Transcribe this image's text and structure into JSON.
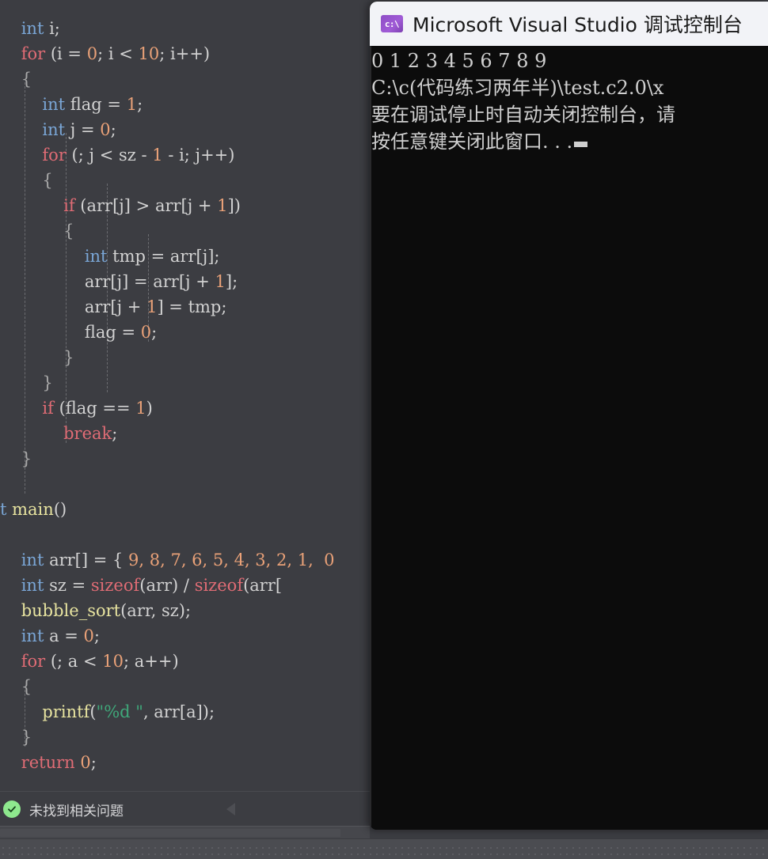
{
  "editor": {
    "background_color": "#3c3d42",
    "code_lines": [
      [
        {
          "t": "    ",
          "c": "plain"
        },
        {
          "t": "int",
          "c": "type"
        },
        {
          "t": " i;",
          "c": "plain"
        }
      ],
      [
        {
          "t": "    ",
          "c": "plain"
        },
        {
          "t": "for",
          "c": "kw"
        },
        {
          "t": " (i = ",
          "c": "plain"
        },
        {
          "t": "0",
          "c": "num"
        },
        {
          "t": "; i ",
          "c": "plain"
        },
        {
          "t": "<",
          "c": "plain"
        },
        {
          "t": " ",
          "c": "plain"
        },
        {
          "t": "10",
          "c": "num"
        },
        {
          "t": "; i++)",
          "c": "plain"
        }
      ],
      [
        {
          "t": "    ",
          "c": "plain"
        },
        {
          "t": "{",
          "c": "brace"
        }
      ],
      [
        {
          "t": "        ",
          "c": "plain"
        },
        {
          "t": "int",
          "c": "type"
        },
        {
          "t": " flag = ",
          "c": "plain"
        },
        {
          "t": "1",
          "c": "num"
        },
        {
          "t": ";",
          "c": "plain"
        }
      ],
      [
        {
          "t": "        ",
          "c": "plain"
        },
        {
          "t": "int",
          "c": "type"
        },
        {
          "t": " j = ",
          "c": "plain"
        },
        {
          "t": "0",
          "c": "num"
        },
        {
          "t": ";",
          "c": "plain"
        }
      ],
      [
        {
          "t": "        ",
          "c": "plain"
        },
        {
          "t": "for",
          "c": "kw"
        },
        {
          "t": " (; j ",
          "c": "plain"
        },
        {
          "t": "<",
          "c": "plain"
        },
        {
          "t": " sz - ",
          "c": "plain"
        },
        {
          "t": "1",
          "c": "num"
        },
        {
          "t": " - i; j++)",
          "c": "plain"
        }
      ],
      [
        {
          "t": "        ",
          "c": "plain"
        },
        {
          "t": "{",
          "c": "brace"
        }
      ],
      [
        {
          "t": "            ",
          "c": "plain"
        },
        {
          "t": "if",
          "c": "kw"
        },
        {
          "t": " (arr[j] ",
          "c": "plain"
        },
        {
          "t": ">",
          "c": "plain"
        },
        {
          "t": " arr[j + ",
          "c": "plain"
        },
        {
          "t": "1",
          "c": "num"
        },
        {
          "t": "])",
          "c": "plain"
        }
      ],
      [
        {
          "t": "            ",
          "c": "plain"
        },
        {
          "t": "{",
          "c": "brace"
        }
      ],
      [
        {
          "t": "                ",
          "c": "plain"
        },
        {
          "t": "int",
          "c": "type"
        },
        {
          "t": " tmp = arr[j];",
          "c": "plain"
        }
      ],
      [
        {
          "t": "                ",
          "c": "plain"
        },
        {
          "t": "arr[j] = arr[j + ",
          "c": "plain"
        },
        {
          "t": "1",
          "c": "num"
        },
        {
          "t": "];",
          "c": "plain"
        }
      ],
      [
        {
          "t": "                ",
          "c": "plain"
        },
        {
          "t": "arr[j + ",
          "c": "plain"
        },
        {
          "t": "1",
          "c": "num"
        },
        {
          "t": "] = tmp;",
          "c": "plain"
        }
      ],
      [
        {
          "t": "                ",
          "c": "plain"
        },
        {
          "t": "flag = ",
          "c": "plain"
        },
        {
          "t": "0",
          "c": "num"
        },
        {
          "t": ";",
          "c": "plain"
        }
      ],
      [
        {
          "t": "            ",
          "c": "plain"
        },
        {
          "t": "}",
          "c": "brace"
        }
      ],
      [
        {
          "t": "        ",
          "c": "plain"
        },
        {
          "t": "}",
          "c": "brace"
        }
      ],
      [
        {
          "t": "        ",
          "c": "plain"
        },
        {
          "t": "if",
          "c": "kw"
        },
        {
          "t": " (flag == ",
          "c": "plain"
        },
        {
          "t": "1",
          "c": "num"
        },
        {
          "t": ")",
          "c": "plain"
        }
      ],
      [
        {
          "t": "            ",
          "c": "plain"
        },
        {
          "t": "break",
          "c": "kw"
        },
        {
          "t": ";",
          "c": "plain"
        }
      ],
      [
        {
          "t": "    ",
          "c": "plain"
        },
        {
          "t": "}",
          "c": "brace"
        }
      ],
      [
        {
          "t": "",
          "c": "plain"
        }
      ],
      [
        {
          "t": "t ",
          "c": "type"
        },
        {
          "t": "main",
          "c": "fn"
        },
        {
          "t": "()",
          "c": "plain"
        }
      ],
      [
        {
          "t": "",
          "c": "plain"
        }
      ],
      [
        {
          "t": "    ",
          "c": "plain"
        },
        {
          "t": "int",
          "c": "type"
        },
        {
          "t": " arr[] = { ",
          "c": "plain"
        },
        {
          "t": "9, 8, 7, 6, 5, 4, 3, 2, 1,  0",
          "c": "num"
        }
      ],
      [
        {
          "t": "    ",
          "c": "plain"
        },
        {
          "t": "int",
          "c": "type"
        },
        {
          "t": " sz = ",
          "c": "plain"
        },
        {
          "t": "sizeof",
          "c": "kw"
        },
        {
          "t": "(arr) / ",
          "c": "plain"
        },
        {
          "t": "sizeof",
          "c": "kw"
        },
        {
          "t": "(arr[",
          "c": "plain"
        }
      ],
      [
        {
          "t": "    ",
          "c": "plain"
        },
        {
          "t": "bubble_sort",
          "c": "fn"
        },
        {
          "t": "(arr, sz);",
          "c": "plain"
        }
      ],
      [
        {
          "t": "    ",
          "c": "plain"
        },
        {
          "t": "int",
          "c": "type"
        },
        {
          "t": " a = ",
          "c": "plain"
        },
        {
          "t": "0",
          "c": "num"
        },
        {
          "t": ";",
          "c": "plain"
        }
      ],
      [
        {
          "t": "    ",
          "c": "plain"
        },
        {
          "t": "for",
          "c": "kw"
        },
        {
          "t": " (; a ",
          "c": "plain"
        },
        {
          "t": "<",
          "c": "plain"
        },
        {
          "t": " ",
          "c": "plain"
        },
        {
          "t": "10",
          "c": "num"
        },
        {
          "t": "; a++)",
          "c": "plain"
        }
      ],
      [
        {
          "t": "    ",
          "c": "plain"
        },
        {
          "t": "{",
          "c": "brace"
        }
      ],
      [
        {
          "t": "        ",
          "c": "plain"
        },
        {
          "t": "printf",
          "c": "fn"
        },
        {
          "t": "(",
          "c": "plain"
        },
        {
          "t": "\"%d \"",
          "c": "str"
        },
        {
          "t": ", arr[a]);",
          "c": "plain"
        }
      ],
      [
        {
          "t": "    ",
          "c": "plain"
        },
        {
          "t": "}",
          "c": "brace"
        }
      ],
      [
        {
          "t": "    ",
          "c": "plain"
        },
        {
          "t": "return",
          "c": "kw"
        },
        {
          "t": " ",
          "c": "plain"
        },
        {
          "t": "0",
          "c": "num"
        },
        {
          "t": ";",
          "c": "plain"
        }
      ]
    ],
    "indent_guides_x": [
      31,
      83,
      135,
      187
    ],
    "status": {
      "icon": "check-circle-icon",
      "icon_color": "#8ee88e",
      "text": "未找到相关问题",
      "collapse_icon": "triangle-left-icon"
    }
  },
  "console": {
    "title": "Microsoft Visual Studio 调试控制台",
    "app_icon": "console-cmd-icon",
    "icon_glyph": "c:\\",
    "titlebar_color": "#f2f3f7",
    "background_color": "#0c0c0c",
    "text_color": "#cfcfcf",
    "lines": [
      "0 1 2 3 4 5 6 7 8 9",
      "C:\\c(代码练习两年半)\\test.c2.0\\x",
      "要在调试停止时自动关闭控制台，请",
      "按任意键关闭此窗口. . ."
    ],
    "caret": "block-cursor"
  }
}
